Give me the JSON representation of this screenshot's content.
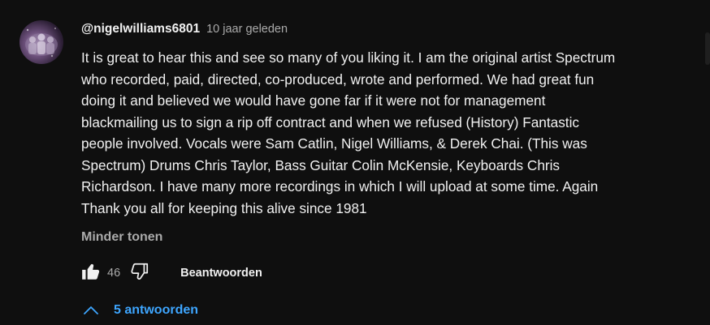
{
  "comment": {
    "author": "@nigelwilliams6801",
    "timestamp": "10 jaar geleden",
    "text": "It is great to hear this and see so many of you liking it. I am the original artist Spectrum\nwho recorded, paid, directed, co-produced, wrote and performed. We had great fun\ndoing it and believed we would have gone far if it were not for management\nblackmailing us to sign a rip off contract and when we refused (History) Fantastic\npeople involved. Vocals were Sam Catlin, Nigel Williams, & Derek Chai. (This was\nSpectrum)  Drums Chris Taylor, Bass Guitar Colin McKensie, Keyboards Chris\nRichardson. I have many more recordings in which I will upload at some time. Again\nThank you all for keeping this alive since 1981",
    "show_less_label": "Minder tonen",
    "like_count": "46",
    "reply_label": "Beantwoorden",
    "replies_label": "5 antwoorden"
  },
  "icons": {
    "avatar": "avatar",
    "like": "thumbs-up-icon",
    "dislike": "thumbs-down-icon",
    "replies_toggle": "chevron-up-icon"
  },
  "colors": {
    "background": "#0f0f0f",
    "text_primary": "#f1f1f1",
    "text_secondary": "#aaaaaa",
    "link_blue": "#3ea6ff"
  }
}
